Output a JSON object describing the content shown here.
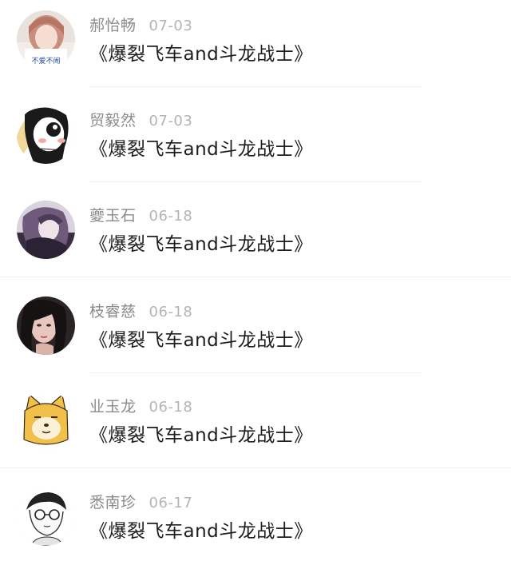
{
  "comments": [
    {
      "name": "郝怡畅",
      "date": "07-03",
      "message": "《爆裂飞车and斗龙战士》",
      "avatar": "girl-pink-hair-avatar",
      "avatar_caption": "不爱不闹"
    },
    {
      "name": "贸毅然",
      "date": "07-03",
      "message": "《爆裂飞车and斗龙战士》",
      "avatar": "cartoon-girl-blush-avatar"
    },
    {
      "name": "夔玉石",
      "date": "06-18",
      "message": "《爆裂飞车and斗龙战士》",
      "avatar": "anime-purple-girl-avatar"
    },
    {
      "name": "枝睿慈",
      "date": "06-18",
      "message": "《爆裂飞车and斗龙战士》",
      "avatar": "dark-hair-girl-avatar"
    },
    {
      "name": "业玉龙",
      "date": "06-18",
      "message": "《爆裂飞车and斗龙战士》",
      "avatar": "shiba-dog-avatar"
    },
    {
      "name": "悉南珍",
      "date": "06-17",
      "message": "《爆裂飞车and斗龙战士》",
      "avatar": "sketch-boy-glasses-avatar"
    }
  ]
}
